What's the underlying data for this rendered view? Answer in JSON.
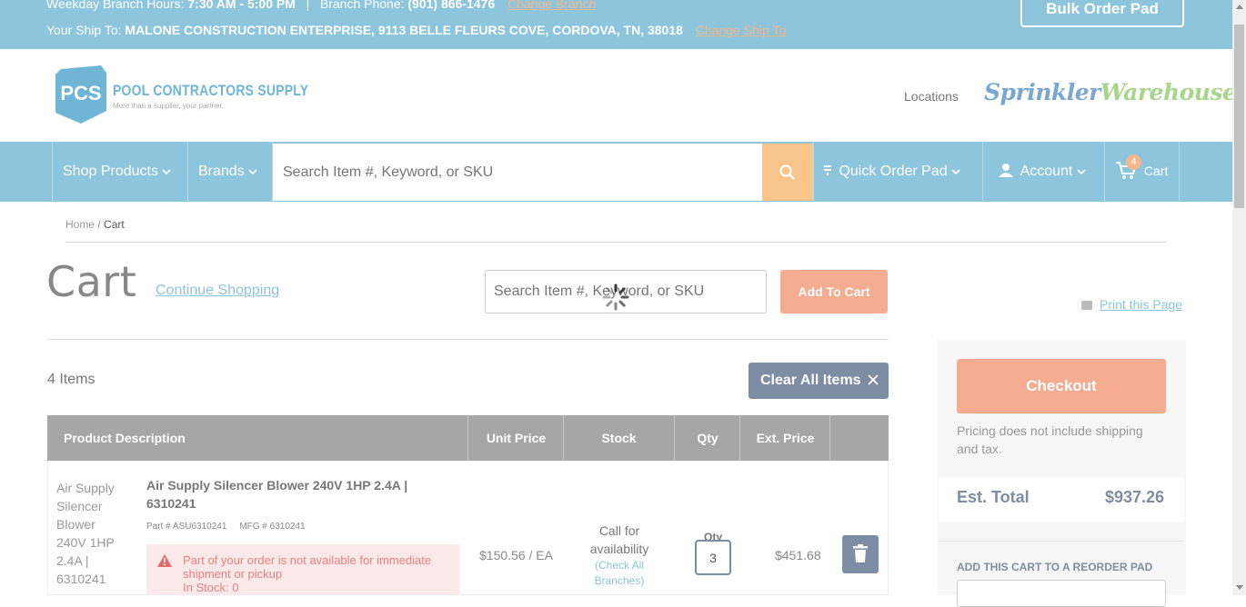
{
  "topbar": {
    "hours_label": "Weekday Branch Hours:",
    "hours_value": "7:30 AM - 5:00 PM",
    "divider": "|",
    "phone_label": "Branch Phone:",
    "phone_value": "(901) 866-1476",
    "change_branch": "Change Branch",
    "ship_label": "Your Ship To:",
    "ship_value": "MALONE CONSTRUCTION ENTERPRISE, 9113 BELLE FLEURS COVE, CORDOVA, TN, 38018",
    "change_ship": "Change Ship To",
    "bulk_order": "Bulk Order Pad"
  },
  "header": {
    "logo_mark": "PCS",
    "logo_name": "POOL CONTRACTORS SUPPLY",
    "logo_tagline": "More than a supplier, your partner.",
    "locations": "Locations",
    "partner_part1": "Sprinkler",
    "partner_part2": "Warehouse"
  },
  "nav": {
    "shop_products": "Shop Products",
    "brands": "Brands",
    "search_placeholder": "Search Item #, Keyword, or SKU",
    "quick_order": "Quick Order Pad",
    "account": "Account",
    "cart": "Cart",
    "cart_count": "4"
  },
  "breadcrumb": {
    "home": "Home",
    "separator": " / ",
    "current": "Cart"
  },
  "cart": {
    "title": "Cart",
    "continue": "Continue Shopping",
    "search_placeholder": "Search Item #, Keyword, or SKU",
    "add_to_cart": "Add To Cart",
    "print": "Print this Page",
    "items_count": "4 Items",
    "clear_all": "Clear All Items"
  },
  "table": {
    "headers": [
      "Product Description",
      "Unit Price",
      "Stock",
      "Qty",
      "Ext. Price"
    ],
    "rows": [
      {
        "img_alt": "Air Supply Silencer Blower 240V 1HP 2.4A | 6310241",
        "name": "Air Supply Silencer Blower 240V 1HP 2.4A | 6310241",
        "part": "Part # ASU6310241",
        "mfg": "MFG # 6310241",
        "alert": "Part of your order is not available for immediate shipment or pickup",
        "in_stock": "In Stock: 0",
        "unit_price": "$150.56 / EA",
        "stock_line1": "Call for",
        "stock_line2": "availability",
        "check_all": "(Check All",
        "check_all2": "Branches)",
        "qty_label": "Qty",
        "qty": "3",
        "ext_price": "$451.68"
      }
    ]
  },
  "sidebar": {
    "checkout": "Checkout",
    "pricing_note": "Pricing does not include shipping and tax.",
    "est_label": "Est. Total",
    "est_value": "$937.26",
    "reorder_label": "ADD THIS CART TO A REORDER PAD"
  },
  "colors": {
    "brand_blue": "#8cc5dc",
    "accent_orange": "#f6ac90",
    "slate": "#7d8da3",
    "table_header": "#a6a6a6"
  }
}
